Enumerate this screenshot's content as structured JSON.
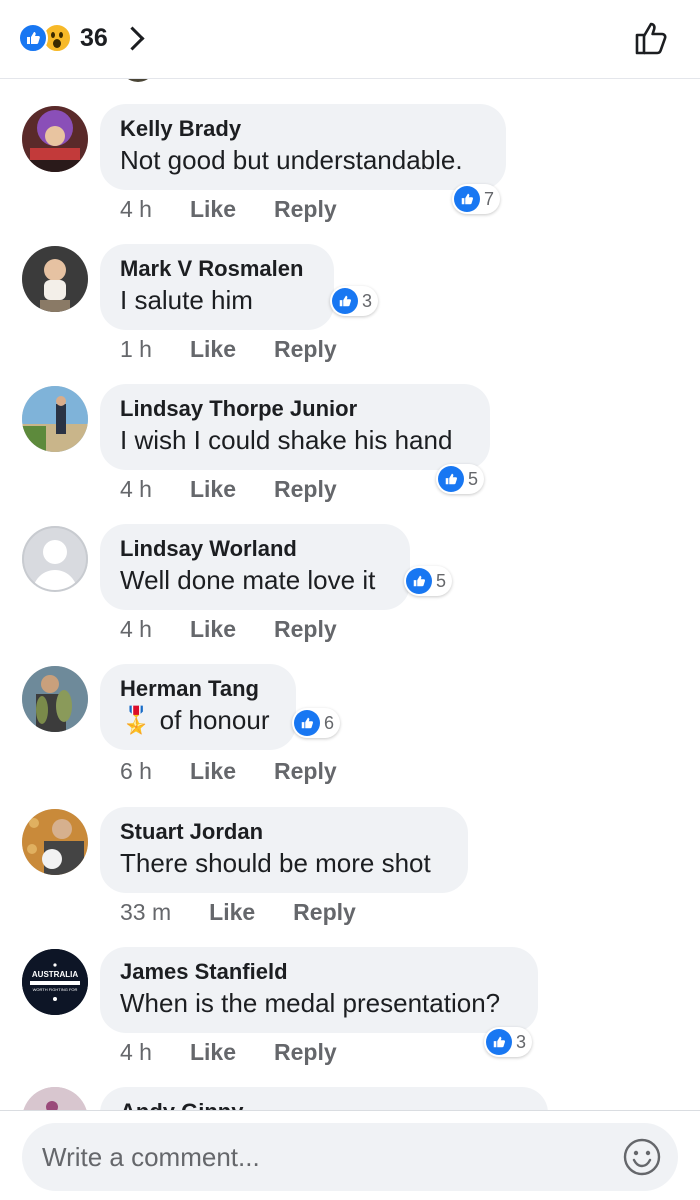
{
  "header": {
    "reaction_count": "36",
    "reaction_icons": [
      "like-icon",
      "wow-icon"
    ],
    "like_button_icon": "thumbs-up-outline-icon"
  },
  "colors": {
    "accent": "#1877f2",
    "bubble": "#f0f2f5",
    "muted": "#65676b",
    "wow": "#f7b928"
  },
  "comments": [
    {
      "author": "Kelly Brady",
      "text": "Not good but understandable.",
      "time": "4 h",
      "like": "Like",
      "reply": "Reply",
      "reactions": "7"
    },
    {
      "author": "Mark V Rosmalen",
      "text": "I salute him",
      "time": "1 h",
      "like": "Like",
      "reply": "Reply",
      "reactions": "3"
    },
    {
      "author": "Lindsay Thorpe Junior",
      "text": "I wish I could shake his hand",
      "time": "4 h",
      "like": "Like",
      "reply": "Reply",
      "reactions": "5"
    },
    {
      "author": "Lindsay Worland",
      "text": "Well done mate love it",
      "time": "4 h",
      "like": "Like",
      "reply": "Reply",
      "reactions": "5"
    },
    {
      "author": "Herman Tang",
      "emoji": "🎖️",
      "text": "of honour",
      "time": "6 h",
      "like": "Like",
      "reply": "Reply",
      "reactions": "6"
    },
    {
      "author": "Stuart Jordan",
      "text": "There should be more shot",
      "time": "33 m",
      "like": "Like",
      "reply": "Reply"
    },
    {
      "author": "James Stanfield",
      "text": "When is the medal presentation?",
      "time": "4 h",
      "like": "Like",
      "reply": "Reply",
      "reactions": "3"
    },
    {
      "author": "Andy Ginny"
    }
  ],
  "avatar_texts": {
    "james_stanfield": {
      "line1": "AUSTRALIA",
      "line2": "WORTH FIGHTING FOR"
    }
  },
  "composer": {
    "placeholder": "Write a comment...",
    "emoji_icon": "smiley-icon"
  }
}
